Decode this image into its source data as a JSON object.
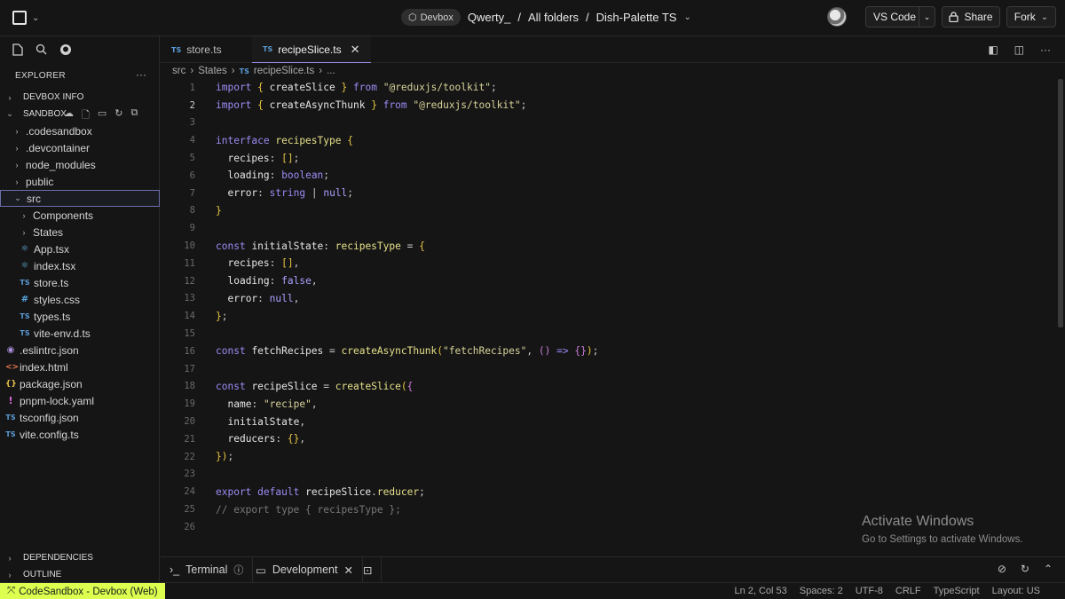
{
  "topbar": {
    "badge": "Devbox",
    "user": "Qwerty_",
    "sep1": "/",
    "folder": "All folders",
    "sep2": "/",
    "project": "Dish-Palette TS",
    "vscode_label": "VS Code",
    "share_label": "Share",
    "fork_label": "Fork"
  },
  "sidebar": {
    "explorer_label": "EXPLORER",
    "devbox_info": "DEVBOX INFO",
    "sandbox": "SANDBOX",
    "dependencies": "DEPENDENCIES",
    "outline": "OUTLINE",
    "tree": [
      {
        "label": ".codesandbox",
        "kind": "folder"
      },
      {
        "label": ".devcontainer",
        "kind": "folder"
      },
      {
        "label": "node_modules",
        "kind": "folder"
      },
      {
        "label": "public",
        "kind": "folder"
      },
      {
        "label": "src",
        "kind": "folder-open"
      },
      {
        "label": "Components",
        "kind": "folder"
      },
      {
        "label": "States",
        "kind": "folder"
      },
      {
        "label": "App.tsx",
        "kind": "react"
      },
      {
        "label": "index.tsx",
        "kind": "react"
      },
      {
        "label": "store.ts",
        "kind": "ts"
      },
      {
        "label": "styles.css",
        "kind": "css"
      },
      {
        "label": "types.ts",
        "kind": "ts"
      },
      {
        "label": "vite-env.d.ts",
        "kind": "ts"
      },
      {
        "label": ".eslintrc.json",
        "kind": "eslint"
      },
      {
        "label": "index.html",
        "kind": "html"
      },
      {
        "label": "package.json",
        "kind": "json"
      },
      {
        "label": "pnpm-lock.yaml",
        "kind": "yaml"
      },
      {
        "label": "tsconfig.json",
        "kind": "tsconfig"
      },
      {
        "label": "vite.config.ts",
        "kind": "ts"
      }
    ]
  },
  "tabs": [
    {
      "label": "store.ts",
      "active": false
    },
    {
      "label": "recipeSlice.ts",
      "active": true
    }
  ],
  "breadcrumb": {
    "a": "src",
    "b": "States",
    "c": "recipeSlice.ts",
    "d": "..."
  },
  "code": {
    "current_line": 2,
    "lines": [
      "import { createSlice } from \"@reduxjs/toolkit\";",
      "import { createAsyncThunk } from \"@reduxjs/toolkit\";",
      "",
      "interface recipesType {",
      "  recipes: [];",
      "  loading: boolean;",
      "  error: string | null;",
      "}",
      "",
      "const initialState: recipesType = {",
      "  recipes: [],",
      "  loading: false,",
      "  error: null,",
      "};",
      "",
      "const fetchRecipes = createAsyncThunk(\"fetchRecipes\", () => {});",
      "",
      "const recipeSlice = createSlice({",
      "  name: \"recipe\",",
      "  initialState,",
      "  reducers: {},",
      "});",
      "",
      "export default recipeSlice.reducer;",
      "// export type { recipesType };",
      ""
    ]
  },
  "watermark": {
    "title": "Activate Windows",
    "subtitle": "Go to Settings to activate Windows."
  },
  "panel": {
    "terminal": "Terminal",
    "development": "Development"
  },
  "status": {
    "left": "CodeSandbox - Devbox (Web)",
    "position": "Ln 2, Col 53",
    "spaces": "Spaces: 2",
    "encoding": "UTF-8",
    "eol": "CRLF",
    "language": "TypeScript",
    "layout": "Layout: US"
  },
  "colors": {
    "accent": "#dcff50",
    "keyword": "#9c8cf5",
    "string": "#d8d39a",
    "background": "#151515"
  }
}
